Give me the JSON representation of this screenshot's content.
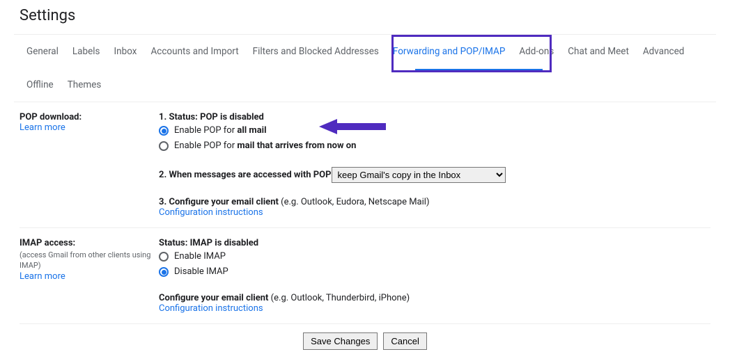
{
  "page_title": "Settings",
  "tabs": {
    "general": "General",
    "labels": "Labels",
    "inbox": "Inbox",
    "accounts": "Accounts and Import",
    "filters": "Filters and Blocked Addresses",
    "forwarding": "Forwarding and POP/IMAP",
    "addons": "Add-ons",
    "chat": "Chat and Meet",
    "advanced": "Advanced",
    "offline": "Offline",
    "themes": "Themes"
  },
  "pop": {
    "section_title": "POP download:",
    "learn_more": "Learn more",
    "status_prefix": "1. Status: ",
    "status_value": "POP is disabled",
    "enable_all_prefix": "Enable POP for ",
    "enable_all_bold": "all mail",
    "enable_now_prefix": "Enable POP for ",
    "enable_now_bold": "mail that arrives from now on",
    "when_accessed": "2. When messages are accessed with POP ",
    "dropdown_value": "keep Gmail's copy in the Inbox",
    "configure_title": "3. Configure your email client ",
    "configure_examples": "(e.g. Outlook, Eudora, Netscape Mail)",
    "config_instructions": "Configuration instructions"
  },
  "imap": {
    "section_title": "IMAP access:",
    "subtitle": "(access Gmail from other clients using IMAP)",
    "learn_more": "Learn more",
    "status_prefix": "Status: ",
    "status_value": "IMAP is disabled",
    "enable": "Enable IMAP",
    "disable": "Disable IMAP",
    "configure_title": "Configure your email client ",
    "configure_examples": "(e.g. Outlook, Thunderbird, iPhone)",
    "config_instructions": "Configuration instructions"
  },
  "buttons": {
    "save": "Save Changes",
    "cancel": "Cancel"
  },
  "colors": {
    "accent": "#1a73e8",
    "annotation": "#4f2bbf"
  }
}
